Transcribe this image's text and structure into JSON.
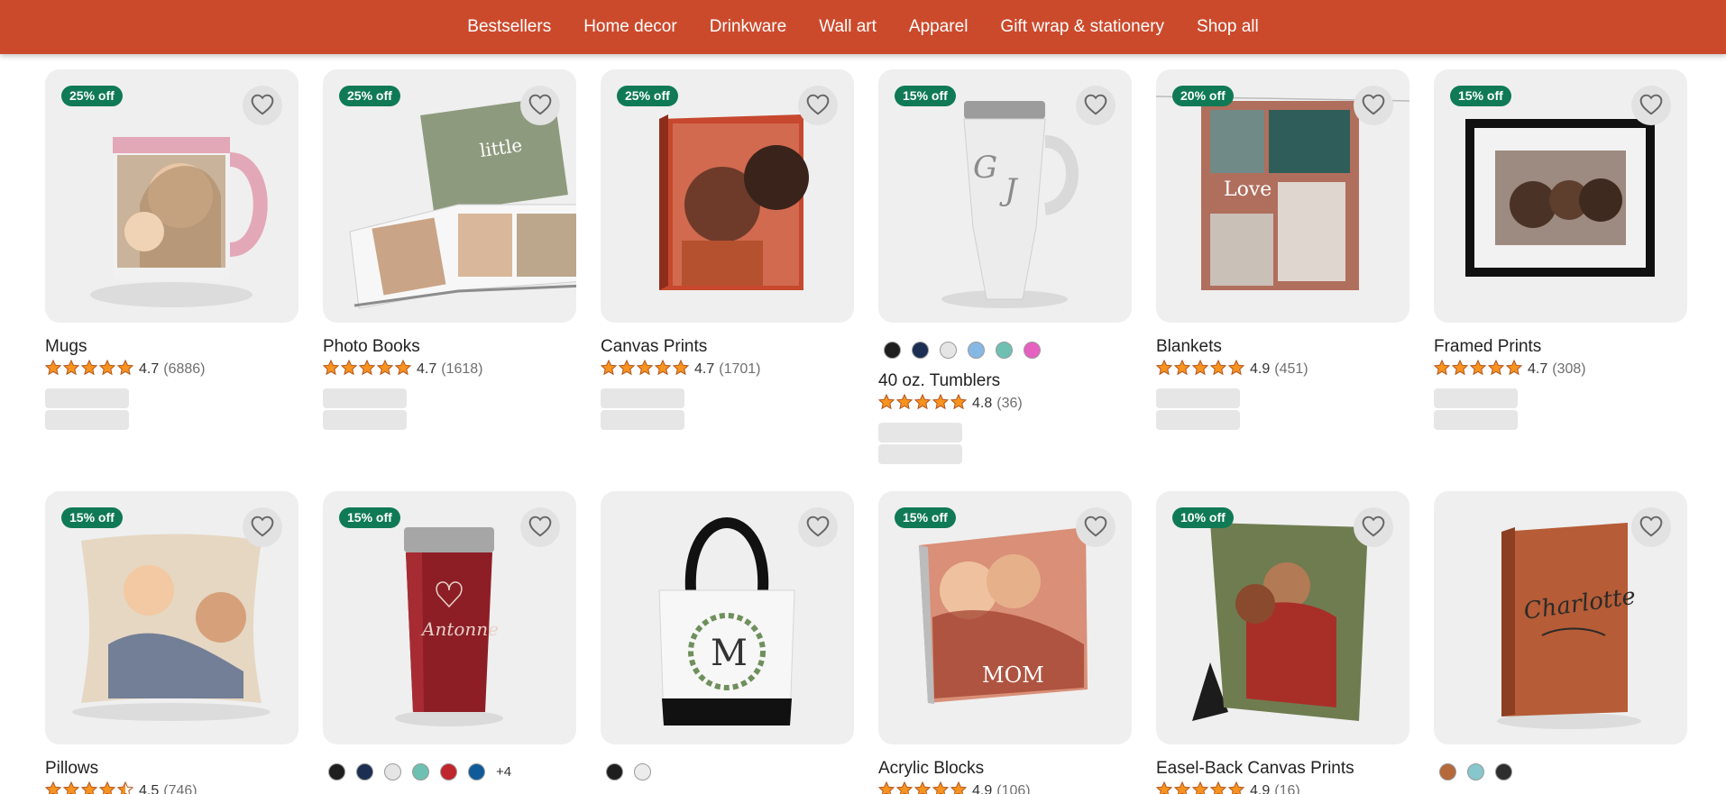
{
  "nav": {
    "items": [
      "Bestsellers",
      "Home decor",
      "Drinkware",
      "Wall art",
      "Apparel",
      "Gift wrap & stationery",
      "Shop all"
    ]
  },
  "colors": {
    "nav_background": "#cc4a2c",
    "badge_background": "#0f7a55",
    "tile_background": "#efefef",
    "star_fill": "#f7931e",
    "star_stroke": "#b3541e"
  },
  "products": [
    {
      "name": "Mugs",
      "badge": "25% off",
      "rating": "4.7",
      "reviews": "(6886)",
      "stars": 5,
      "image_icon": "mug-icon"
    },
    {
      "name": "Photo Books",
      "badge": "25% off",
      "rating": "4.7",
      "reviews": "(1618)",
      "stars": 5,
      "image_icon": "photo-book-icon"
    },
    {
      "name": "Canvas Prints",
      "badge": "25% off",
      "rating": "4.7",
      "reviews": "(1701)",
      "stars": 5,
      "image_icon": "canvas-print-icon"
    },
    {
      "name": "40 oz. Tumblers",
      "badge": "15% off",
      "rating": "4.8",
      "reviews": "(36)",
      "stars": 5,
      "image_icon": "tumbler-icon",
      "swatches": [
        "#1e1e1e",
        "#1c2f52",
        "#e5e5e5",
        "#86b8e4",
        "#6ec0b2",
        "#e660c0"
      ]
    },
    {
      "name": "Blankets",
      "badge": "20% off",
      "rating": "4.9",
      "reviews": "(451)",
      "stars": 5,
      "image_icon": "blanket-icon"
    },
    {
      "name": "Framed Prints",
      "badge": "15% off",
      "rating": "4.7",
      "reviews": "(308)",
      "stars": 5,
      "image_icon": "framed-print-icon"
    },
    {
      "name": "Pillows",
      "badge": "15% off",
      "rating": "4.5",
      "reviews": "(746)",
      "stars": 4.5,
      "image_icon": "pillow-icon"
    },
    {
      "name": "",
      "badge": "15% off",
      "image_icon": "insulated-tumbler-icon",
      "swatches": [
        "#1e1e1e",
        "#1c2f52",
        "#e5e5e5",
        "#6ec0b2",
        "#c0262d",
        "#0f5b9a"
      ],
      "more_colors": "+4"
    },
    {
      "name": "",
      "badge": "",
      "image_icon": "tote-bag-icon",
      "swatches": [
        "#1e1e1e",
        "#ececec"
      ]
    },
    {
      "name": "Acrylic Blocks",
      "badge": "15% off",
      "rating": "4.9",
      "reviews": "(106)",
      "stars": 5,
      "image_icon": "acrylic-block-icon"
    },
    {
      "name": "Easel-Back Canvas Prints",
      "badge": "10% off",
      "rating": "4.9",
      "reviews": "(16)",
      "stars": 5,
      "image_icon": "easel-canvas-icon"
    },
    {
      "name": "",
      "badge": "",
      "image_icon": "journal-icon",
      "swatches": [
        "#b5683a",
        "#86c6cc",
        "#2e2e2e"
      ]
    }
  ]
}
